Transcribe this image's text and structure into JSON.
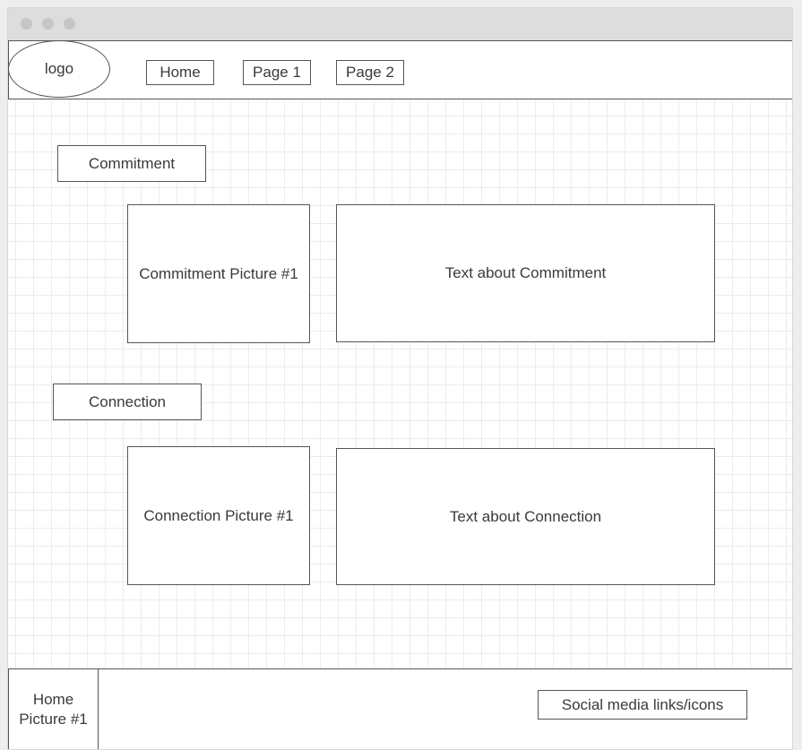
{
  "nav": {
    "logo": "logo",
    "items": [
      {
        "label": "Home"
      },
      {
        "label": "Page 1"
      },
      {
        "label": "Page 2"
      }
    ]
  },
  "sections": [
    {
      "heading": "Commitment",
      "picture": "Commitment Picture #1",
      "text": "Text about Commitment"
    },
    {
      "heading": "Connection",
      "picture": "Connection Picture #1",
      "text": "Text about Connection"
    }
  ],
  "footer": {
    "picture_line1": "Home",
    "picture_line2": "Picture #1",
    "social": "Social media links/icons"
  }
}
